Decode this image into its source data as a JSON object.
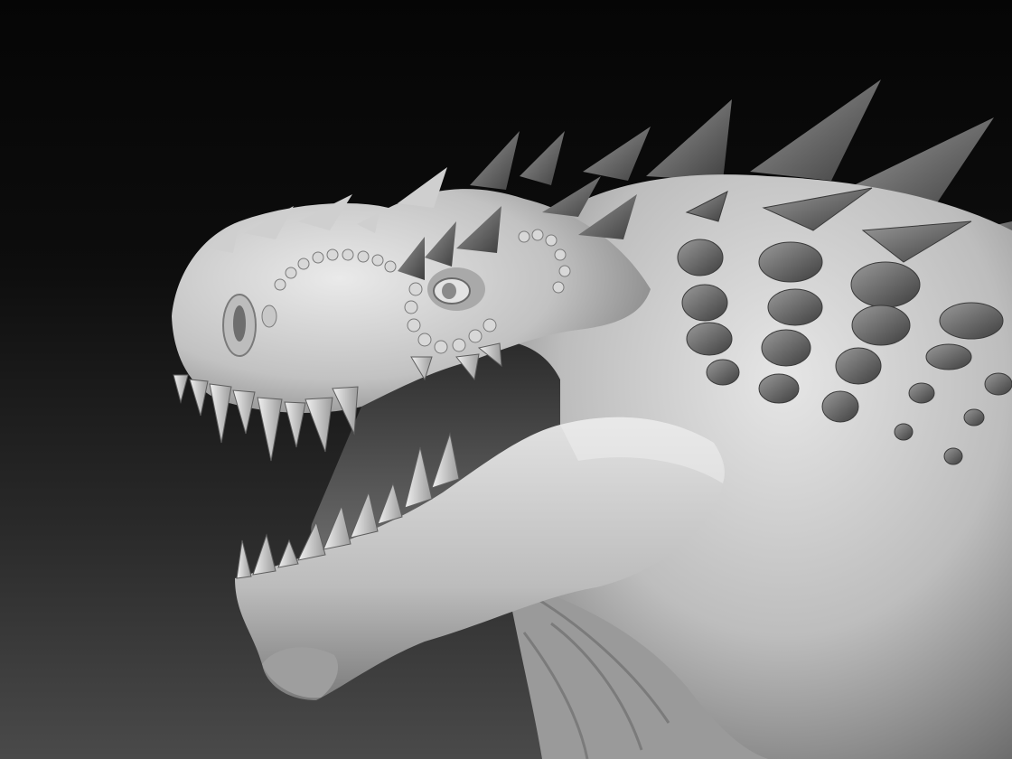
{
  "scene": {
    "subject": "",
    "palette": {
      "background_top": "#050505",
      "background_bottom": "#4a4a4a",
      "clay_light": "#dcdcdc",
      "clay_mid": "#a8a8a8",
      "clay_dark": "#5a5a5a",
      "spike_dark": "#6e6e6e"
    }
  }
}
